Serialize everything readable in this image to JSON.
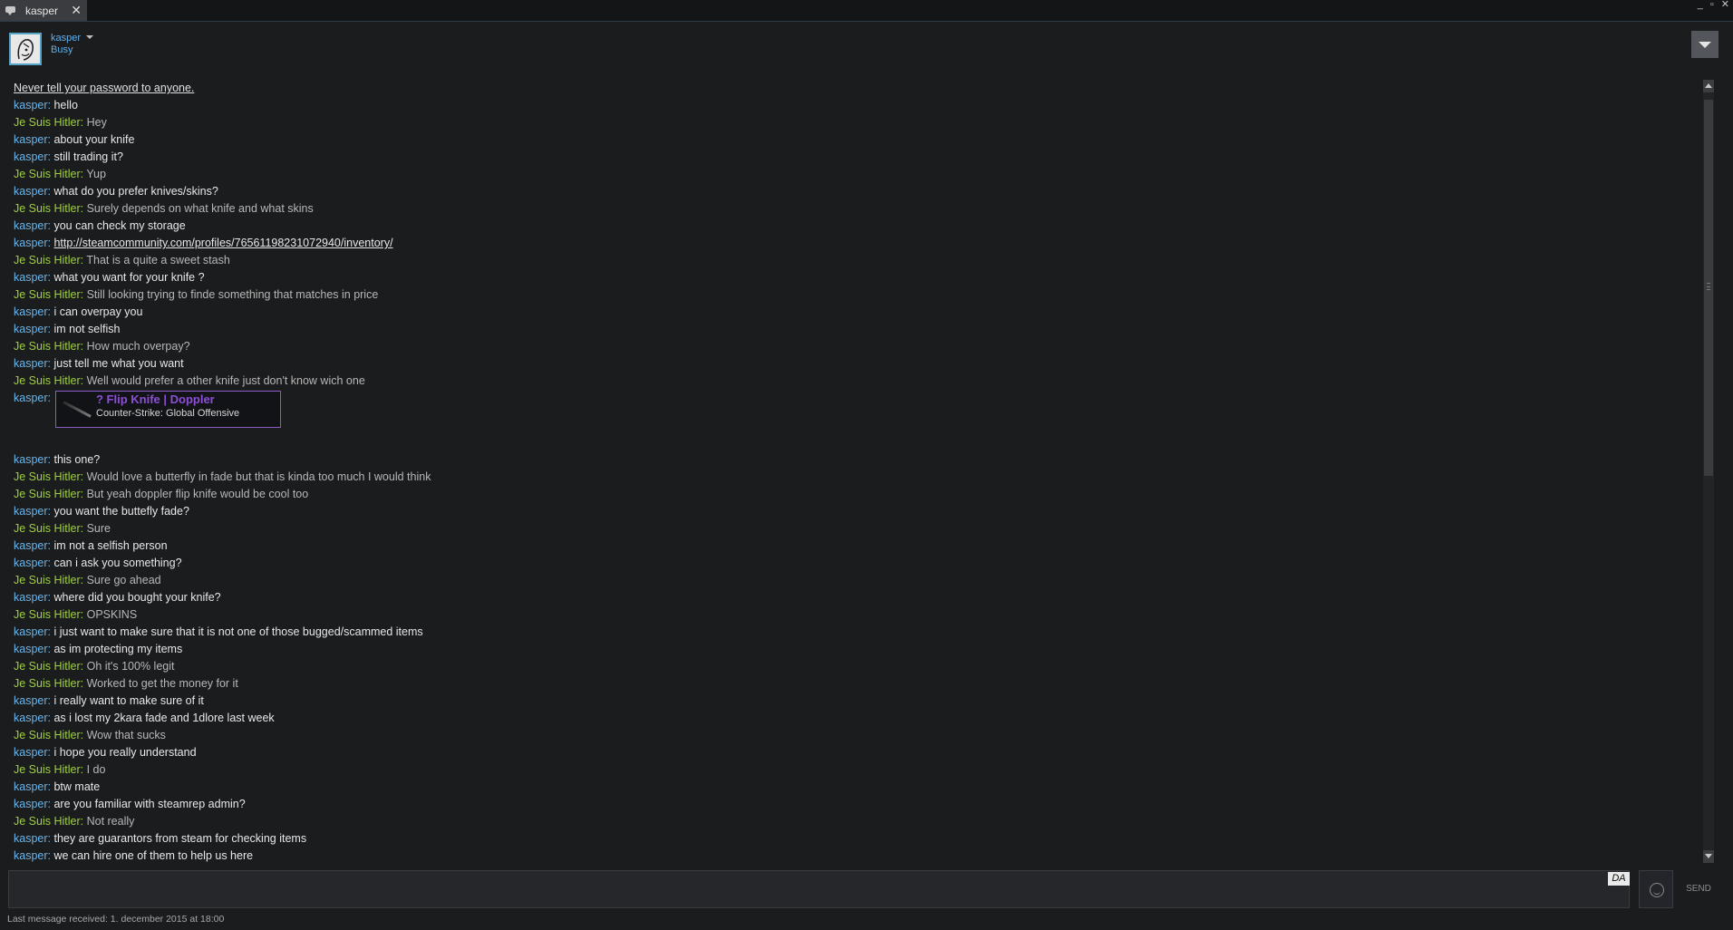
{
  "window": {
    "tab_title": "kasper",
    "tab_close": "✕",
    "controls": {
      "minimize": "_",
      "maximize": "▫",
      "close": "✕"
    }
  },
  "header": {
    "username": "kasper",
    "status": "Busy",
    "avatar_icon": "avatar-sketch-face"
  },
  "colors": {
    "self_name": "#6cb5e9",
    "other_name": "#9fce45",
    "item_border": "#8b5cc4",
    "item_name": "#8c4fd6",
    "avatar_border": "#57a4c9"
  },
  "chat": {
    "warning": "Never tell your password to anyone.",
    "messages": [
      {
        "sender": "kasper",
        "self": true,
        "text": "hello"
      },
      {
        "sender": "Je Suis Hitler",
        "self": false,
        "text": "Hey"
      },
      {
        "sender": "kasper",
        "self": true,
        "text": "about your knife"
      },
      {
        "sender": "kasper",
        "self": true,
        "text": "still trading it?"
      },
      {
        "sender": "Je Suis Hitler",
        "self": false,
        "text": "Yup"
      },
      {
        "sender": "kasper",
        "self": true,
        "text": "what do you prefer knives/skins?"
      },
      {
        "sender": "Je Suis Hitler",
        "self": false,
        "text": "Surely depends on what knife and what skins"
      },
      {
        "sender": "kasper",
        "self": true,
        "text": "you can check my storage"
      },
      {
        "sender": "kasper",
        "self": true,
        "text": "http://steamcommunity.com/profiles/76561198231072940/inventory/",
        "link": true
      },
      {
        "sender": "Je Suis Hitler",
        "self": false,
        "text": "That is a quite a sweet stash"
      },
      {
        "sender": "kasper",
        "self": true,
        "text": "what you want for your knife ?"
      },
      {
        "sender": "Je Suis Hitler",
        "self": false,
        "text": "Still looking trying to finde something that matches in price"
      },
      {
        "sender": "kasper",
        "self": true,
        "text": "i can overpay you"
      },
      {
        "sender": "kasper",
        "self": true,
        "text": "im not selfish"
      },
      {
        "sender": "Je Suis Hitler",
        "self": false,
        "text": "How much overpay?"
      },
      {
        "sender": "kasper",
        "self": true,
        "text": "just tell me what you want"
      },
      {
        "sender": "Je Suis Hitler",
        "self": false,
        "text": "Well would prefer a other knife just don't know wich one"
      },
      {
        "sender": "kasper",
        "self": true,
        "item": {
          "name": "? Flip Knife | Doppler",
          "game": "Counter-Strike: Global Offensive"
        }
      },
      {
        "sender": "kasper",
        "self": true,
        "text": "this one?"
      },
      {
        "sender": "Je Suis Hitler",
        "self": false,
        "text": "Would love a butterfly in fade but that is kinda too much I would think"
      },
      {
        "sender": "Je Suis Hitler",
        "self": false,
        "text": "But yeah doppler flip knife would be cool too"
      },
      {
        "sender": "kasper",
        "self": true,
        "text": "you want the buttefly fade?"
      },
      {
        "sender": "Je Suis Hitler",
        "self": false,
        "text": "Sure"
      },
      {
        "sender": "kasper",
        "self": true,
        "text": "im not a selfish person"
      },
      {
        "sender": "kasper",
        "self": true,
        "text": "can i ask you something?"
      },
      {
        "sender": "Je Suis Hitler",
        "self": false,
        "text": "Sure go ahead"
      },
      {
        "sender": "kasper",
        "self": true,
        "text": "where did you bought your knife?"
      },
      {
        "sender": "Je Suis Hitler",
        "self": false,
        "text": "OPSKINS"
      },
      {
        "sender": "kasper",
        "self": true,
        "text": "i just want to make sure that it is not one of those bugged/scammed items"
      },
      {
        "sender": "kasper",
        "self": true,
        "text": "as im protecting my items"
      },
      {
        "sender": "Je Suis Hitler",
        "self": false,
        "text": "Oh it's 100% legit"
      },
      {
        "sender": "Je Suis Hitler",
        "self": false,
        "text": "Worked to get the money for it"
      },
      {
        "sender": "kasper",
        "self": true,
        "text": "i really want to make sure of it"
      },
      {
        "sender": "kasper",
        "self": true,
        "text": "as i lost my 2kara fade and 1dlore last week"
      },
      {
        "sender": "Je Suis Hitler",
        "self": false,
        "text": "Wow that sucks"
      },
      {
        "sender": "kasper",
        "self": true,
        "text": "i hope you really understand"
      },
      {
        "sender": "Je Suis Hitler",
        "self": false,
        "text": "I do"
      },
      {
        "sender": "kasper",
        "self": true,
        "text": "btw mate"
      },
      {
        "sender": "kasper",
        "self": true,
        "text": "are you familiar with steamrep admin?"
      },
      {
        "sender": "Je Suis Hitler",
        "self": false,
        "text": "Not really"
      },
      {
        "sender": "kasper",
        "self": true,
        "text": "they are guarantors from steam for checking items"
      },
      {
        "sender": "kasper",
        "self": true,
        "text": "we can hire one of them to help us here"
      }
    ]
  },
  "input": {
    "value": "",
    "placeholder": "",
    "language_badge": "DA",
    "emoticon_icon": "smiley-icon",
    "send_label": "SEND"
  },
  "footer": {
    "last_message": "Last message received: 1. december 2015 at 18:00"
  }
}
